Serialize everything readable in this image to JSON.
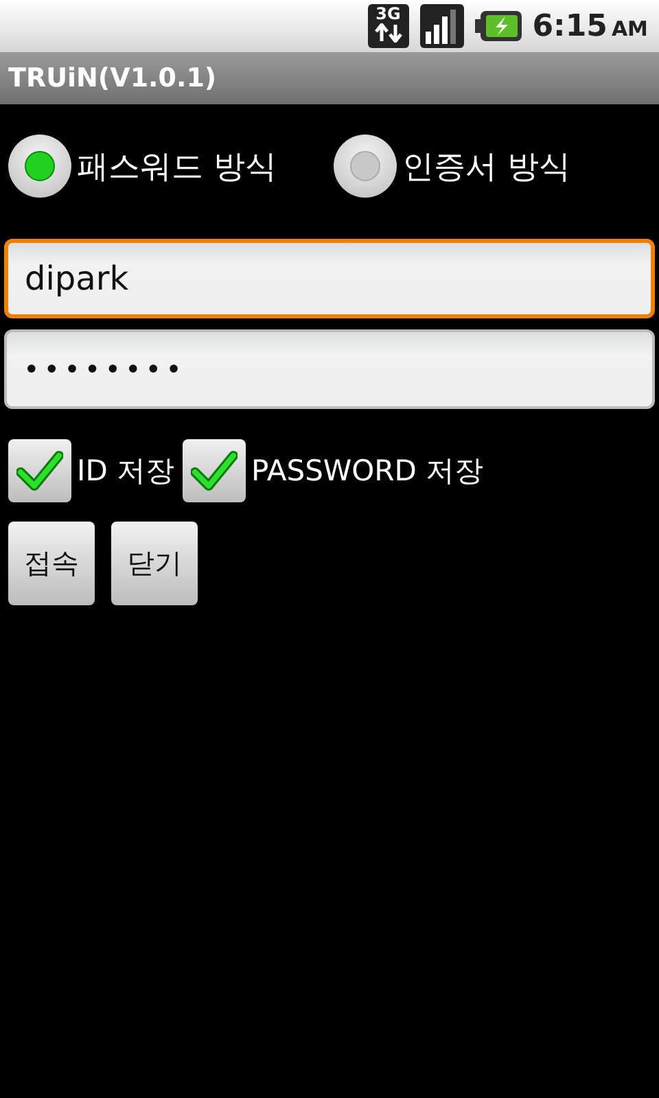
{
  "status_bar": {
    "network": "3G",
    "time": "6:15",
    "ampm": "AM"
  },
  "window": {
    "title": "TRUiN(V1.0.1)"
  },
  "auth_modes": [
    {
      "label": "패스워드 방식",
      "selected": true
    },
    {
      "label": "인증서 방식",
      "selected": false
    }
  ],
  "fields": [
    {
      "kind": "text",
      "value": "dipark",
      "focused": true
    },
    {
      "kind": "password",
      "value": "••••••••",
      "focused": false
    }
  ],
  "checkboxes": [
    {
      "label": "ID 저장",
      "checked": true
    },
    {
      "label": "PASSWORD 저장",
      "checked": true
    }
  ],
  "buttons": [
    "접속",
    "닫기"
  ]
}
